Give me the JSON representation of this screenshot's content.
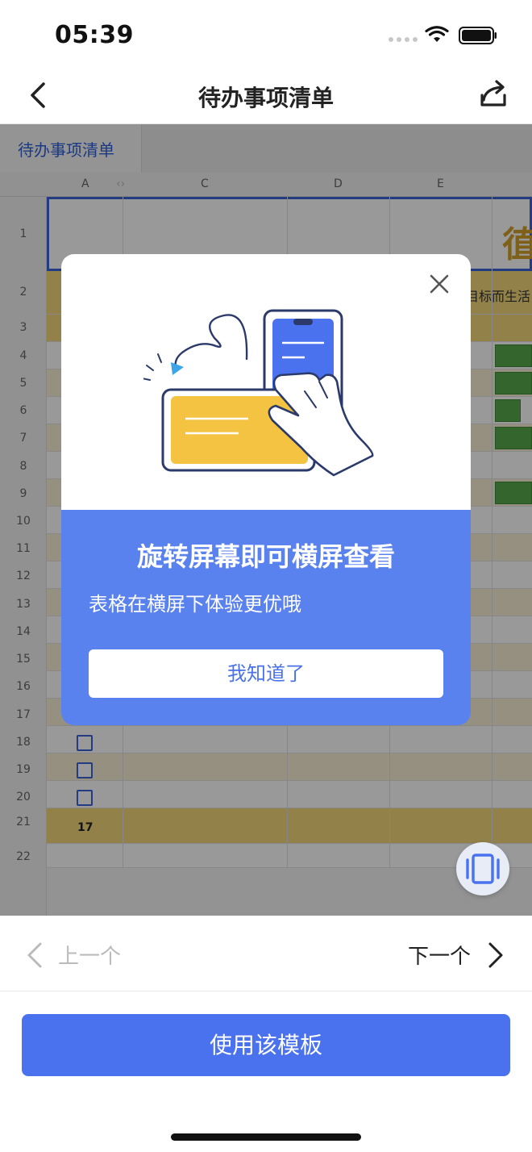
{
  "status_bar": {
    "time": "05:39"
  },
  "nav": {
    "title": "待办事项清单"
  },
  "sheet": {
    "tab_label": "待办事项清单",
    "columns": [
      "A",
      "C",
      "D",
      "E"
    ],
    "rows": [
      "1",
      "2",
      "3",
      "4",
      "5",
      "6",
      "7",
      "8",
      "9",
      "10",
      "11",
      "12",
      "13",
      "14",
      "15",
      "16",
      "17",
      "18",
      "19",
      "20",
      "21",
      "22"
    ],
    "title_char": "徝",
    "subtitle_fragment": "直目标而生活",
    "row21_value": "17"
  },
  "modal": {
    "title": "旋转屏幕即可横屏查看",
    "description": "表格在横屏下体验更优哦",
    "ok_label": "我知道了"
  },
  "pager": {
    "prev_label": "上一个",
    "next_label": "下一个"
  },
  "primary_button": {
    "label": "使用该模板"
  },
  "colors": {
    "accent": "#4a72ee",
    "modal_bg": "#5a82ee",
    "sheet_yellow": "#f3d77a",
    "green_bar": "#57a94a"
  }
}
